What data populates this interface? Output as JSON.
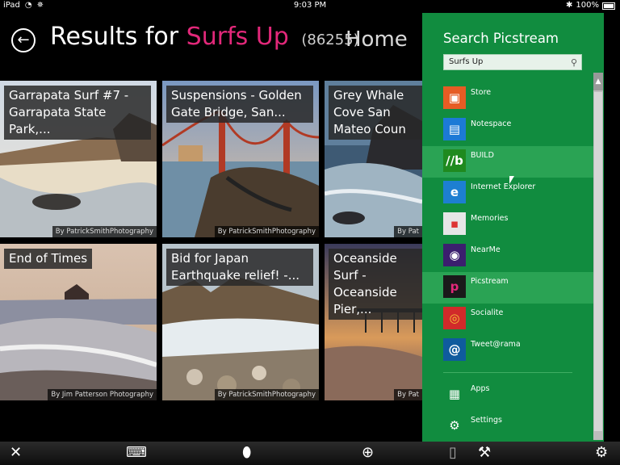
{
  "statusbar": {
    "device": "iPad",
    "time": "9:03 PM",
    "battery": "100%"
  },
  "header": {
    "title_prefix": "Results for",
    "query": "Surfs Up",
    "count": "(86255)",
    "home": "Home"
  },
  "tiles": [
    {
      "caption": "Garrapata Surf #7 - Garrapata State Park,...",
      "credit": "By PatrickSmithPhotography"
    },
    {
      "caption": "Suspensions - Golden Gate Bridge, San...",
      "credit": "By PatrickSmithPhotography"
    },
    {
      "caption": "Grey Whale Cove San Mateo Coun",
      "credit": "By Pat"
    },
    {
      "caption": "End of Times",
      "credit": "By Jim Patterson Photography"
    },
    {
      "caption": "Bid for Japan Earthquake relief! -...",
      "credit": "By PatrickSmithPhotography"
    },
    {
      "caption": "Oceanside Surf - Oceanside Pier,...",
      "credit": "By Pat"
    }
  ],
  "panel": {
    "title": "Search Picstream",
    "search_value": "Surfs Up",
    "apps": [
      {
        "label": "Store",
        "icon": "store-icon",
        "color": "#e65c24"
      },
      {
        "label": "Notespace",
        "icon": "notespace-icon",
        "color": "#1c7ad6"
      },
      {
        "label": "BUILD",
        "icon": "build-icon",
        "color": "#1f8a1f"
      },
      {
        "label": "Internet Explorer",
        "icon": "internet-explorer-icon",
        "color": "#1d7fd1"
      },
      {
        "label": "Memories",
        "icon": "memories-icon",
        "color": "#e6e6e6"
      },
      {
        "label": "NearMe",
        "icon": "nearme-icon",
        "color": "#3b1f6e"
      },
      {
        "label": "Picstream",
        "icon": "picstream-icon",
        "color": "#1a1a1a"
      },
      {
        "label": "Socialite",
        "icon": "socialite-icon",
        "color": "#d12a2a"
      },
      {
        "label": "Tweet@rama",
        "icon": "tweetrama-icon",
        "color": "#0f5b9e"
      },
      {
        "label": "Apps",
        "icon": "apps-icon",
        "color": "#118c3f"
      },
      {
        "label": "Settings",
        "icon": "settings-icon",
        "color": "#118c3f"
      }
    ]
  },
  "bottombar": {
    "icons": [
      "close-icon",
      "keyboard-icon",
      "mouse-icon",
      "zoom-icon",
      "file-icon",
      "wrench-icon",
      "gear-icon"
    ]
  }
}
